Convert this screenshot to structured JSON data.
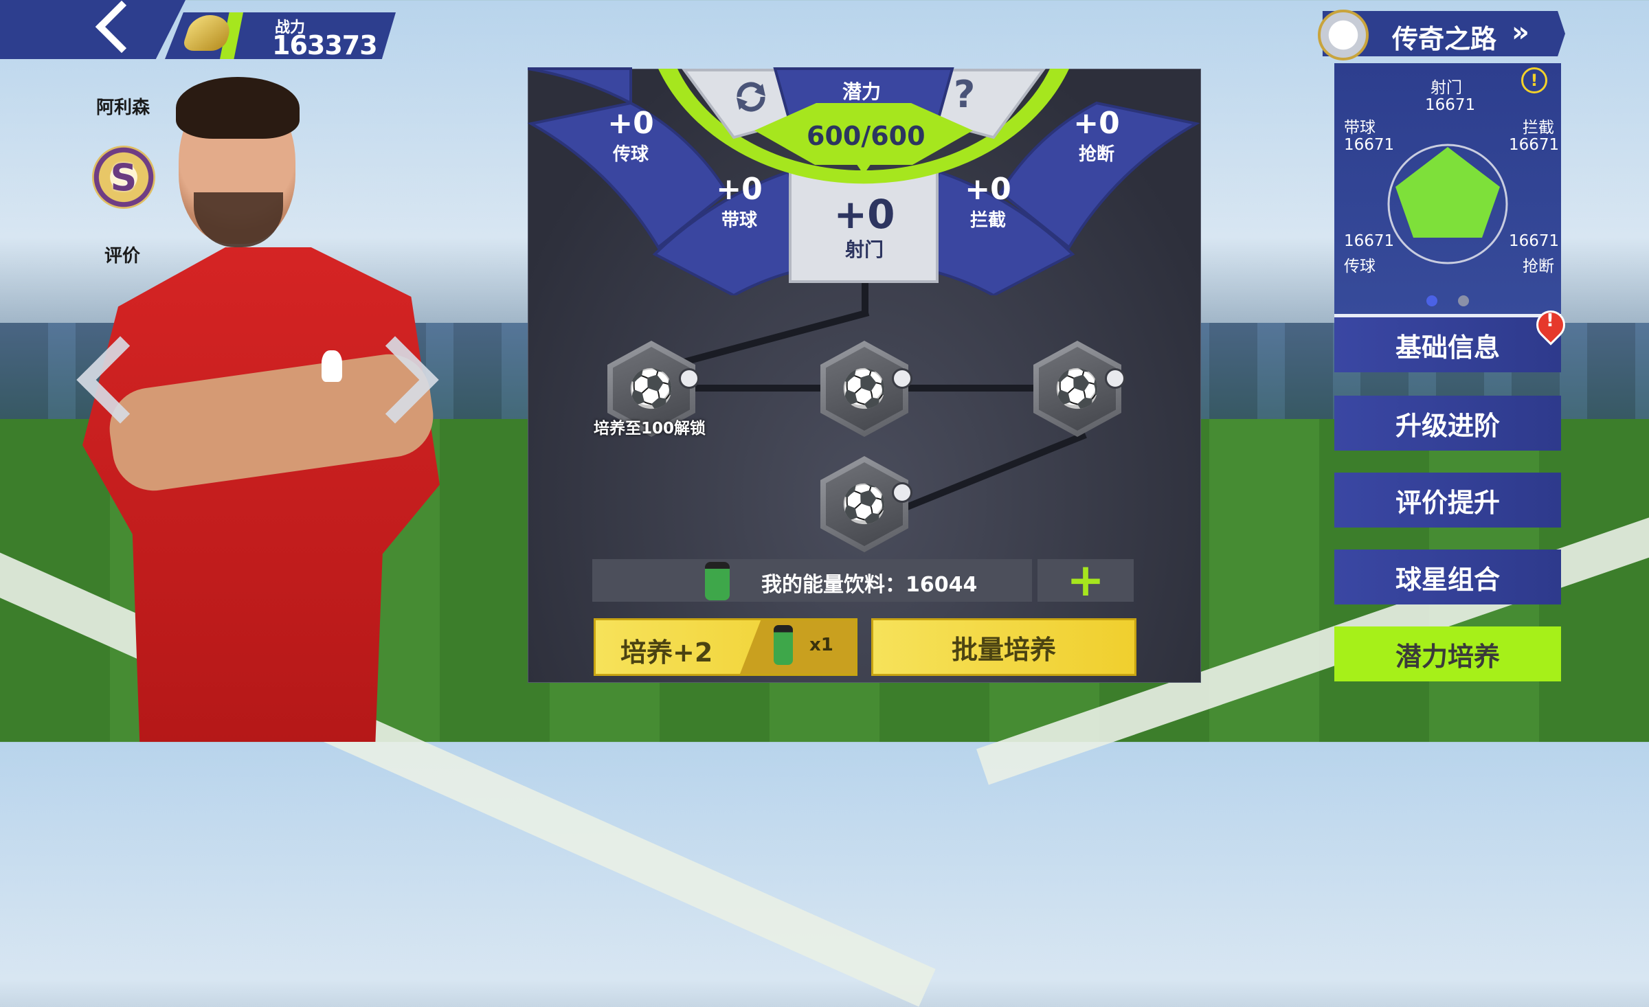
{
  "header": {
    "power_label": "战力",
    "power_value": "163373"
  },
  "player": {
    "name": "阿利森",
    "rating_grade": "S",
    "rating_label": "评价"
  },
  "potential": {
    "title": "潜力",
    "value": "600/600",
    "stats": [
      {
        "key": "pass",
        "gain": "+0",
        "label": "传球"
      },
      {
        "key": "dribble",
        "gain": "+0",
        "label": "带球"
      },
      {
        "key": "shoot",
        "gain": "+0",
        "label": "射门"
      },
      {
        "key": "intercept",
        "gain": "+0",
        "label": "拦截"
      },
      {
        "key": "tackle",
        "gain": "+0",
        "label": "抢断"
      }
    ],
    "unlock_hint": "培养至100解锁",
    "energy_text": "我的能量饮料：16044",
    "train_button": "培养+2",
    "train_cost": "x1",
    "batch_button": "批量培养"
  },
  "legend_road": {
    "title": "传奇之路"
  },
  "radar": {
    "top": {
      "label": "射门",
      "value": "16671"
    },
    "left_top": {
      "label": "带球",
      "value": "16671"
    },
    "right_top": {
      "label": "拦截",
      "value": "16671"
    },
    "left_bottom": {
      "label": "传球",
      "value": "16671"
    },
    "right_bottom": {
      "label": "抢断",
      "value": "16671"
    },
    "page_indicator": {
      "current": 1,
      "total": 2
    }
  },
  "menu": [
    {
      "label": "基础信息",
      "active": false,
      "alert": true
    },
    {
      "label": "升级进阶",
      "active": false
    },
    {
      "label": "评价提升",
      "active": false
    },
    {
      "label": "球星组合",
      "active": false
    },
    {
      "label": "潜力培养",
      "active": true
    }
  ],
  "colors": {
    "accent_lime": "#a6e61e",
    "panel_blue": "#2d3e8e",
    "button_yellow": "#f0cf2e"
  }
}
